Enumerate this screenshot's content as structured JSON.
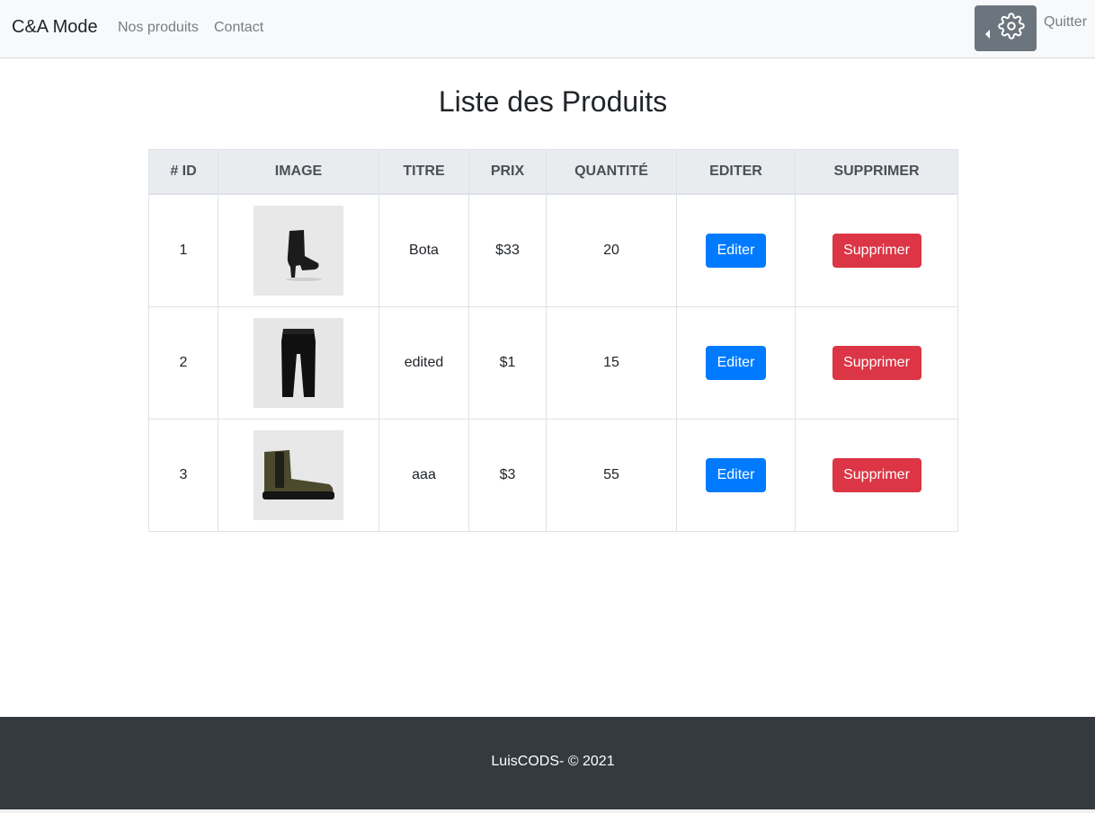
{
  "navbar": {
    "brand": "C&A Mode",
    "links": [
      {
        "label": "Nos produits"
      },
      {
        "label": "Contact"
      }
    ],
    "settings_icon": "gear-icon",
    "quit_label": "Quitter"
  },
  "main": {
    "title": "Liste des Produits",
    "table": {
      "headers": [
        "# ID",
        "IMAGE",
        "TITRE",
        "PRIX",
        "QUANTITÉ",
        "EDITER",
        "SUPPRIMER"
      ],
      "rows": [
        {
          "id": "1",
          "image": "black-ankle-boot",
          "title": "Bota",
          "price": "$33",
          "quantity": "20",
          "edit_label": "Editer",
          "delete_label": "Supprimer"
        },
        {
          "id": "2",
          "image": "black-jogger-pants",
          "title": "edited",
          "price": "$1",
          "quantity": "15",
          "edit_label": "Editer",
          "delete_label": "Supprimer"
        },
        {
          "id": "3",
          "image": "khaki-chelsea-boot",
          "title": "aaa",
          "price": "$3",
          "quantity": "55",
          "edit_label": "Editer",
          "delete_label": "Supprimer"
        }
      ]
    }
  },
  "footer": {
    "text": "LuisCODS- © 2021"
  },
  "colors": {
    "primary": "#007bff",
    "danger": "#dc3545",
    "secondary": "#6c757d",
    "footer_bg": "#343a40",
    "navbar_bg": "#f8f9fa"
  }
}
